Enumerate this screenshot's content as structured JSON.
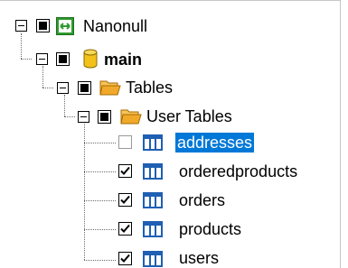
{
  "tree": {
    "root": {
      "label": "Nanonull",
      "expanded": true,
      "icon": "database-server-icon"
    },
    "schema": {
      "label": "main",
      "expanded": true,
      "icon": "database-cylinder-icon"
    },
    "tables_folder": {
      "label": "Tables",
      "expanded": true,
      "icon": "folder-icon"
    },
    "user_tables_folder": {
      "label": "User Tables",
      "expanded": true,
      "icon": "folder-icon"
    },
    "tables": [
      {
        "label": "addresses",
        "checked": false,
        "selected": true,
        "icon": "table-icon"
      },
      {
        "label": "orderedproducts",
        "checked": true,
        "selected": false,
        "icon": "table-icon"
      },
      {
        "label": "orders",
        "checked": true,
        "selected": false,
        "icon": "table-icon"
      },
      {
        "label": "products",
        "checked": true,
        "selected": false,
        "icon": "table-icon"
      },
      {
        "label": "users",
        "checked": true,
        "selected": false,
        "icon": "table-icon"
      }
    ]
  },
  "colors": {
    "selection": "#0078d7",
    "server_icon": "#2e9b2e",
    "db_icon": "#f2c21b",
    "folder_icon": "#f0a92a",
    "table_icon": "#1f5fb4"
  }
}
